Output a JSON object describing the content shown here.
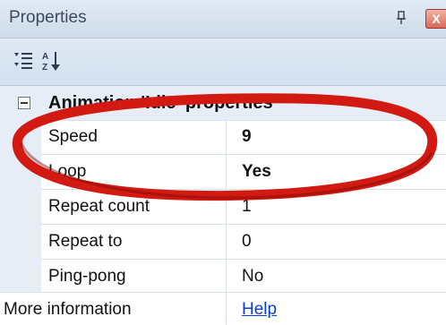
{
  "panel": {
    "title": "Properties",
    "pin_glyph": "p",
    "close_glyph": "X"
  },
  "toolbar": {
    "buttons": [
      {
        "icon": "categorized-icon"
      },
      {
        "icon": "alphabetical-sort-icon"
      }
    ]
  },
  "grid": {
    "category": "Animation 'Idle' properties",
    "rows": [
      {
        "name": "Speed",
        "value": "9",
        "bold": true
      },
      {
        "name": "Loop",
        "value": "Yes",
        "bold": true
      },
      {
        "name": "Repeat count",
        "value": "1",
        "bold": false
      },
      {
        "name": "Repeat to",
        "value": "0",
        "bold": false
      },
      {
        "name": "Ping-pong",
        "value": "No",
        "bold": false
      }
    ],
    "info": {
      "name": "More information",
      "link": "Help"
    }
  },
  "colors": {
    "highlight_ellipse": "#d21a12",
    "link": "#0a3cd6"
  }
}
